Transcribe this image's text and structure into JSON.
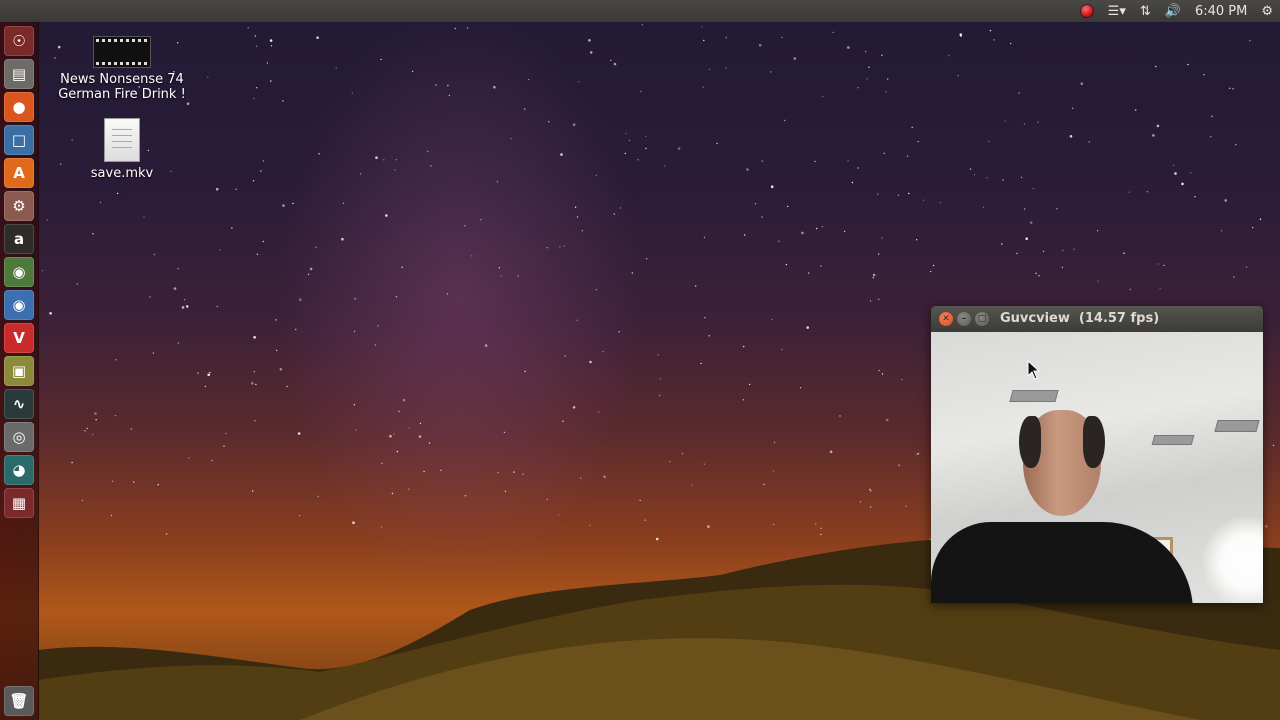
{
  "top_panel": {
    "time": "6:40 PM",
    "indicators": [
      "record-indicator-icon",
      "menu-icon",
      "network-icon",
      "volume-icon",
      "gear-icon"
    ],
    "colors": {
      "panel": "#3c3b37",
      "record": "#c4101a"
    }
  },
  "launcher": {
    "items": [
      {
        "name": "dash-home",
        "icon": "ubuntu-logo-icon"
      },
      {
        "name": "files",
        "icon": "file-cabinet-icon"
      },
      {
        "name": "firefox",
        "icon": "firefox-icon"
      },
      {
        "name": "writer",
        "icon": "document-icon"
      },
      {
        "name": "software-center",
        "icon": "shopping-bag-icon"
      },
      {
        "name": "system-settings",
        "icon": "wrench-gear-icon"
      },
      {
        "name": "amazon",
        "icon": "amazon-icon"
      },
      {
        "name": "chrome",
        "icon": "chrome-icon"
      },
      {
        "name": "chromium",
        "icon": "chromium-icon"
      },
      {
        "name": "vivaldi",
        "icon": "vivaldi-icon"
      },
      {
        "name": "archive-manager",
        "icon": "archive-icon"
      },
      {
        "name": "system-monitor",
        "icon": "monitor-icon"
      },
      {
        "name": "webcam",
        "icon": "webcam-icon"
      },
      {
        "name": "web-browser",
        "icon": "globe-icon"
      },
      {
        "name": "workspaces",
        "icon": "workspace-icon"
      },
      {
        "name": "trash",
        "icon": "trash-icon"
      }
    ]
  },
  "desktop": {
    "icons": [
      {
        "label_line1": "News Nonsense 74",
        "label_line2": "German Fire Drink !",
        "icon": "video-file-icon"
      },
      {
        "label_line1": "save.mkv",
        "icon": "text-file-icon"
      }
    ]
  },
  "window": {
    "title": "Guvcview  (14.57 fps)",
    "buttons": [
      "close",
      "minimize",
      "maximize"
    ]
  }
}
